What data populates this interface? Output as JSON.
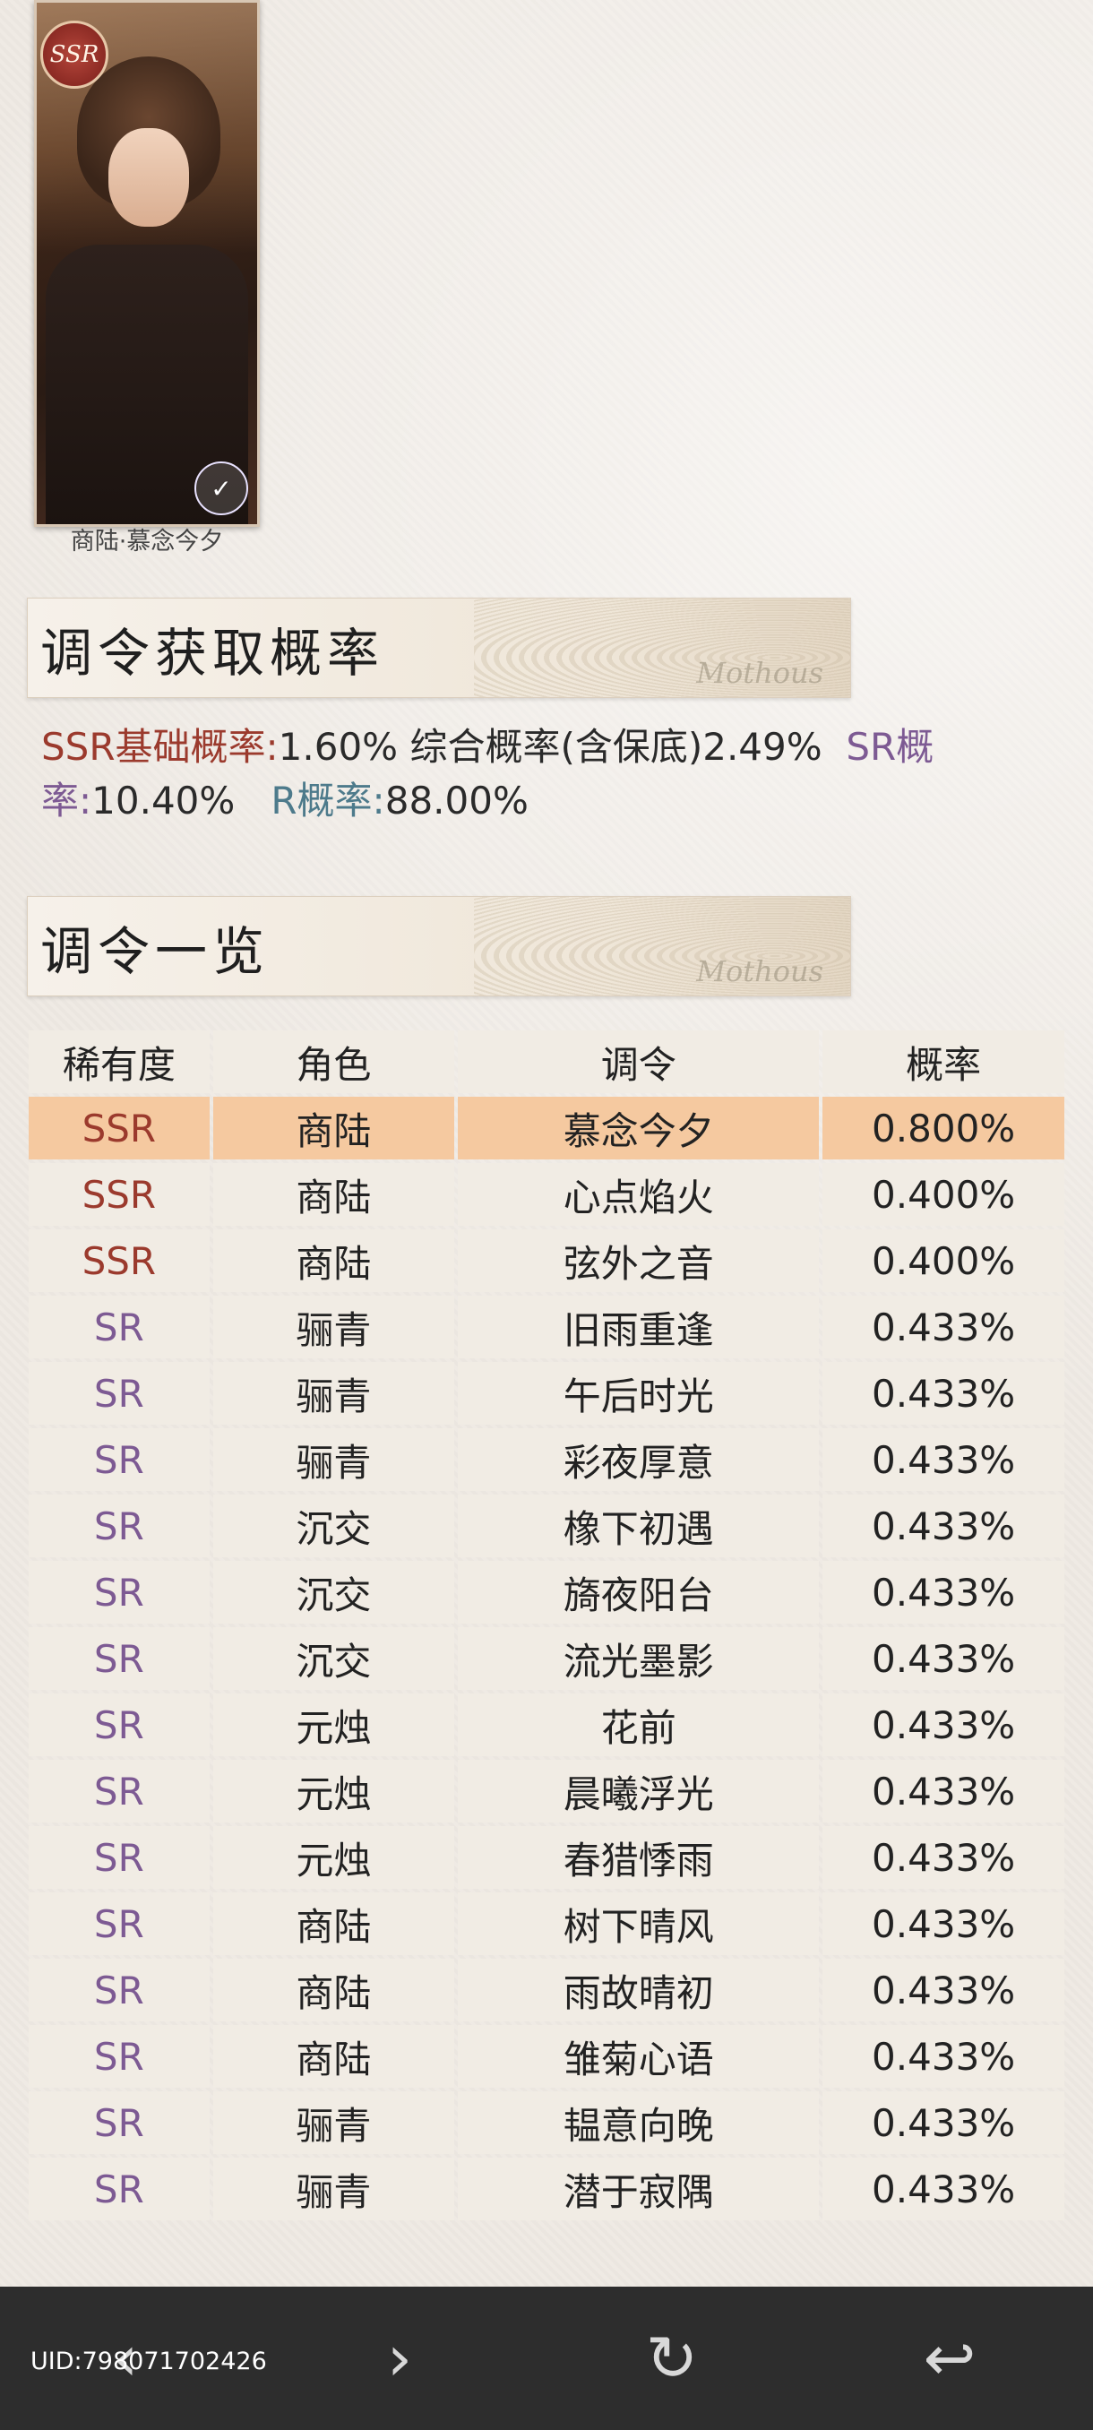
{
  "card": {
    "rarity_badge": "SSR",
    "caption": "商陆·慕念今夕",
    "icon": "check-sparkle-icon"
  },
  "sections": {
    "rates_title": "调令获取概率",
    "list_title": "调令一览",
    "decorative_script": "Mothous"
  },
  "rates": {
    "ssr_label": "SSR基础概率:",
    "ssr_value": "1.60%",
    "combined": "综合概率(含保底)2.49%",
    "sr_label": "SR概率:",
    "sr_value": "10.40%",
    "r_label": "R概率:",
    "r_value": "88.00%"
  },
  "table": {
    "headers": [
      "稀有度",
      "角色",
      "调令",
      "概率"
    ],
    "rows": [
      {
        "rarity": "SSR",
        "character": "商陆",
        "card": "慕念今夕",
        "rate": "0.800%"
      },
      {
        "rarity": "SSR",
        "character": "商陆",
        "card": "心点焰火",
        "rate": "0.400%"
      },
      {
        "rarity": "SSR",
        "character": "商陆",
        "card": "弦外之音",
        "rate": "0.400%"
      },
      {
        "rarity": "SR",
        "character": "骊青",
        "card": "旧雨重逢",
        "rate": "0.433%"
      },
      {
        "rarity": "SR",
        "character": "骊青",
        "card": "午后时光",
        "rate": "0.433%"
      },
      {
        "rarity": "SR",
        "character": "骊青",
        "card": "彩夜厚意",
        "rate": "0.433%"
      },
      {
        "rarity": "SR",
        "character": "沉交",
        "card": "橡下初遇",
        "rate": "0.433%"
      },
      {
        "rarity": "SR",
        "character": "沉交",
        "card": "旖夜阳台",
        "rate": "0.433%"
      },
      {
        "rarity": "SR",
        "character": "沉交",
        "card": "流光墨影",
        "rate": "0.433%"
      },
      {
        "rarity": "SR",
        "character": "元烛",
        "card": "花前",
        "rate": "0.433%"
      },
      {
        "rarity": "SR",
        "character": "元烛",
        "card": "晨曦浮光",
        "rate": "0.433%"
      },
      {
        "rarity": "SR",
        "character": "元烛",
        "card": "春猎悸雨",
        "rate": "0.433%"
      },
      {
        "rarity": "SR",
        "character": "商陆",
        "card": "树下晴风",
        "rate": "0.433%"
      },
      {
        "rarity": "SR",
        "character": "商陆",
        "card": "雨故晴初",
        "rate": "0.433%"
      },
      {
        "rarity": "SR",
        "character": "商陆",
        "card": "雏菊心语",
        "rate": "0.433%"
      },
      {
        "rarity": "SR",
        "character": "骊青",
        "card": "韫意向晚",
        "rate": "0.433%"
      },
      {
        "rarity": "SR",
        "character": "骊青",
        "card": "潜于寂隅",
        "rate": "0.433%"
      }
    ]
  },
  "navbar": {
    "uid": "UID:798071702426",
    "back_icon": "chevron-left-icon",
    "forward_icon": "chevron-right-icon",
    "refresh_icon": "refresh-icon",
    "exit_icon": "exit-icon"
  },
  "colors": {
    "ssr": "#9b3a2d",
    "sr": "#7d5a93",
    "r": "#4d7a8b",
    "highlight_row": "#f5c9a0"
  }
}
